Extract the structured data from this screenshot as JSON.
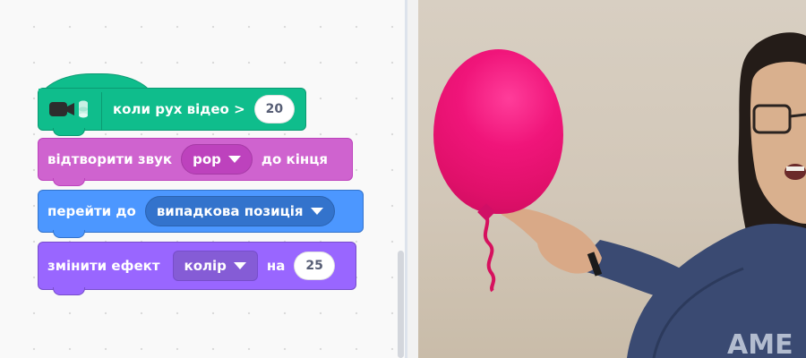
{
  "blocks": {
    "hat": {
      "label": "коли рух відео >",
      "value": "20",
      "icon": "video-sensing-icon",
      "color": "#0fbd8c"
    },
    "sound": {
      "label_before": "відтворити звук",
      "dropdown": "pop",
      "label_after": "до кінця",
      "color": "#cf63cf"
    },
    "motion": {
      "label": "перейти до",
      "dropdown": "випадкова позиція",
      "color": "#4c97ff"
    },
    "looks": {
      "label": "змінити ефект",
      "dropdown": "колір",
      "label_mid": "на",
      "value": "25",
      "color": "#9966ff"
    }
  },
  "stage": {
    "content": "video-feed-with-balloon-sprite",
    "balloon_color": "#f0157a"
  }
}
